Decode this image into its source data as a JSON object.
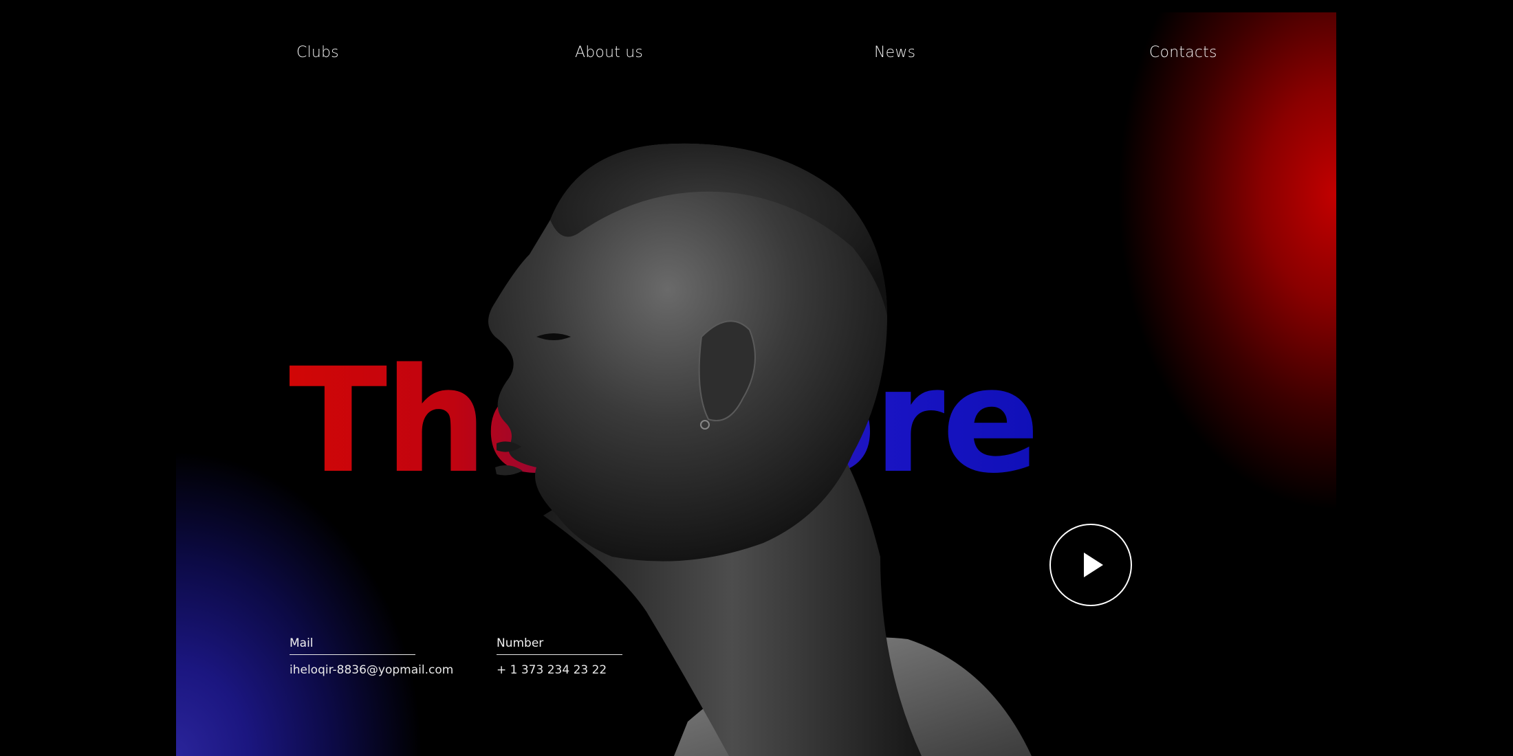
{
  "nav": {
    "items": [
      {
        "label": "Clubs"
      },
      {
        "label": "About us"
      },
      {
        "label": "News"
      },
      {
        "label": "Contacts"
      }
    ]
  },
  "hero": {
    "title": "Theodore"
  },
  "contact": {
    "mail_label": "Mail",
    "mail_value": "iheloqir-8836@yopmail.com",
    "number_label": "Number",
    "number_value": "+ 1 373 234 23 22"
  },
  "colors": {
    "background": "#000000",
    "accent_red": "#c20000",
    "accent_blue": "#1010b8",
    "text": "#ffffff"
  },
  "icons": {
    "play": "play-icon"
  }
}
